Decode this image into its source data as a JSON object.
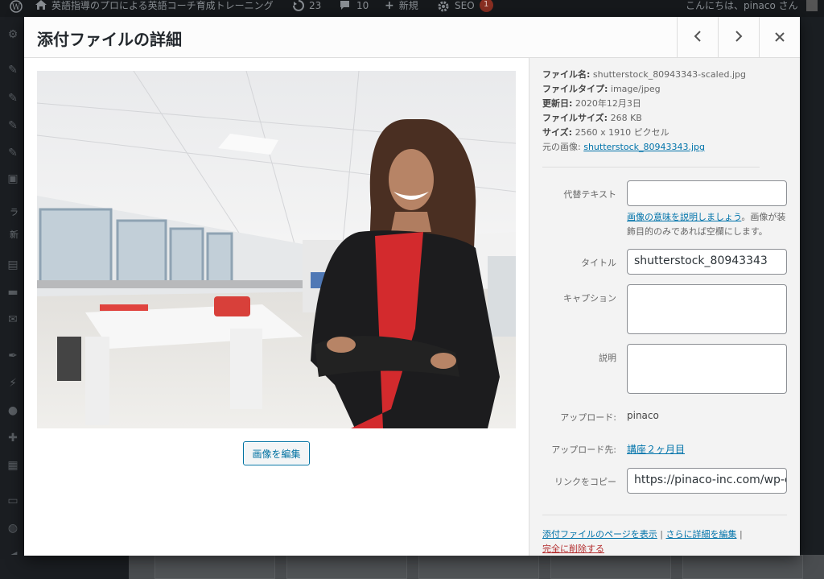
{
  "admin_bar": {
    "site_name": "英語指導のプロによる英語コーチ育成トレーニング",
    "updates_count": "23",
    "comments_count": "10",
    "new_label": "新規",
    "seo_label": "SEO",
    "seo_badge": "1",
    "greeting": "こんにちは、pinaco さん"
  },
  "admin_menu": {
    "items": [
      "ラ",
      "新"
    ]
  },
  "modal": {
    "title": "添付ファイルの詳細",
    "edit_image_label": "画像を編集",
    "details": {
      "file_name_label": "ファイル名:",
      "file_name": "shutterstock_80943343-scaled.jpg",
      "file_type_label": "ファイルタイプ:",
      "file_type": "image/jpeg",
      "updated_label": "更新日:",
      "updated": "2020年12月3日",
      "file_size_label": "ファイルサイズ:",
      "file_size": "268 KB",
      "size_label": "サイズ:",
      "size": "2560 x 1910 ピクセル",
      "original_label": "元の画像:",
      "original": "shutterstock_80943343.jpg"
    },
    "fields": {
      "alt_label": "代替テキスト",
      "alt_value": "",
      "alt_help_link": "画像の意味を説明しましょう",
      "alt_help_text": "。画像が装飾目的のみであれば空欄にします。",
      "title_label": "タイトル",
      "title_value": "shutterstock_80943343",
      "caption_label": "キャプション",
      "caption_value": "",
      "description_label": "説明",
      "description_value": "",
      "uploaded_by_label": "アップロード:",
      "uploaded_by": "pinaco",
      "uploaded_to_label": "アップロード先:",
      "uploaded_to": "講座２ヶ月目",
      "copy_link_label": "リンクをコピー",
      "copy_link_value": "https://pinaco-inc.com/wp-c"
    },
    "actions": {
      "view_page": "添付ファイルのページを表示",
      "edit_more": "さらに詳細を編集",
      "delete": "完全に削除する"
    }
  }
}
